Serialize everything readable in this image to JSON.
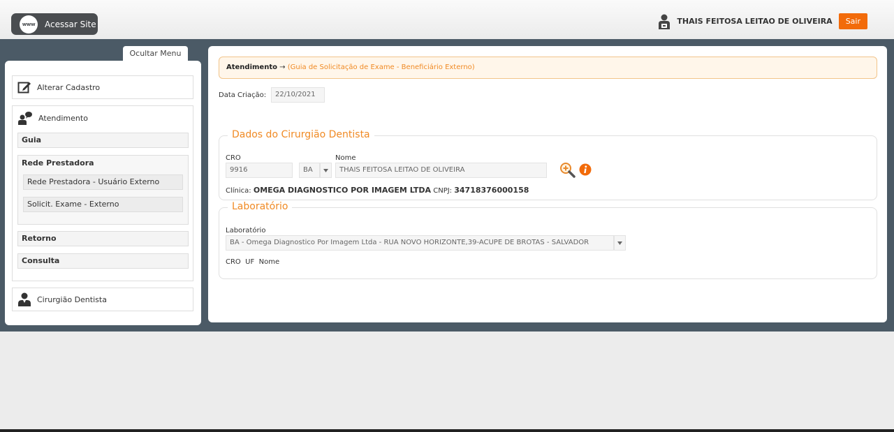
{
  "header": {
    "site_button": {
      "label": "Acessar Site",
      "icon_text": "www"
    },
    "user_name": "THAIS FEITOSA LEITAO DE OLIVEIRA",
    "logout_label": "Sair"
  },
  "sidebar": {
    "toggle_label": "Ocultar Menu",
    "alterar_cadastro": "Alterar Cadastro",
    "atendimento": "Atendimento",
    "guia": "Guia",
    "rede_prestadora": "Rede Prestadora",
    "rede_items": [
      "Rede Prestadora - Usuário Externo",
      "Solicit. Exame - Externo"
    ],
    "retorno": "Retorno",
    "consulta": "Consulta",
    "cirurgiao_dentista": "Cirurgião Dentista"
  },
  "breadcrumb": {
    "main": "Atendimento",
    "arrow": "→",
    "sub": "(Guia de Solicitação de Exame - Beneficiário Externo)"
  },
  "data_criacao": {
    "label": "Data Criação:",
    "value": "22/10/2021"
  },
  "dentista": {
    "legend": "Dados do Cirurgião Dentista",
    "cro_label": "CRO",
    "cro_value": "9916",
    "uf_value": "BA",
    "nome_label": "Nome",
    "nome_value": "THAIS FEITOSA LEITAO DE OLIVEIRA",
    "clinica_label": "Clínica:",
    "clinica_value": "OMEGA DIAGNOSTICO POR IMAGEM LTDA",
    "cnpj_label": "CNPJ:",
    "cnpj_value": "34718376000158"
  },
  "laboratorio": {
    "legend": "Laboratório",
    "label": "Laboratório",
    "selected": "BA - Omega Diagnostico Por Imagem Ltda - RUA NOVO HORIZONTE,39-ACUPE DE BROTAS - SALVADOR",
    "columns": [
      "CRO",
      "UF",
      "Nome"
    ]
  },
  "colors": {
    "accent": "#f08a24",
    "button_orange": "#f26b0a",
    "band": "#4b5a66"
  }
}
